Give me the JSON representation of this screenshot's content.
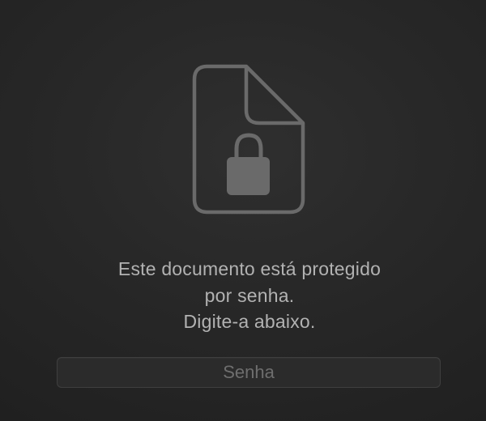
{
  "icon": {
    "name": "locked-document-icon",
    "color": "#6a6a6a"
  },
  "message": {
    "line1": "Este documento está protegido",
    "line2": "por senha.",
    "line3": "Digite-a abaixo."
  },
  "password": {
    "placeholder": "Senha",
    "value": ""
  },
  "colors": {
    "text": "#b2b2b2",
    "placeholder": "#6e6e6e",
    "field_background": "#2b2b2b",
    "field_border": "#3f3f3f"
  }
}
